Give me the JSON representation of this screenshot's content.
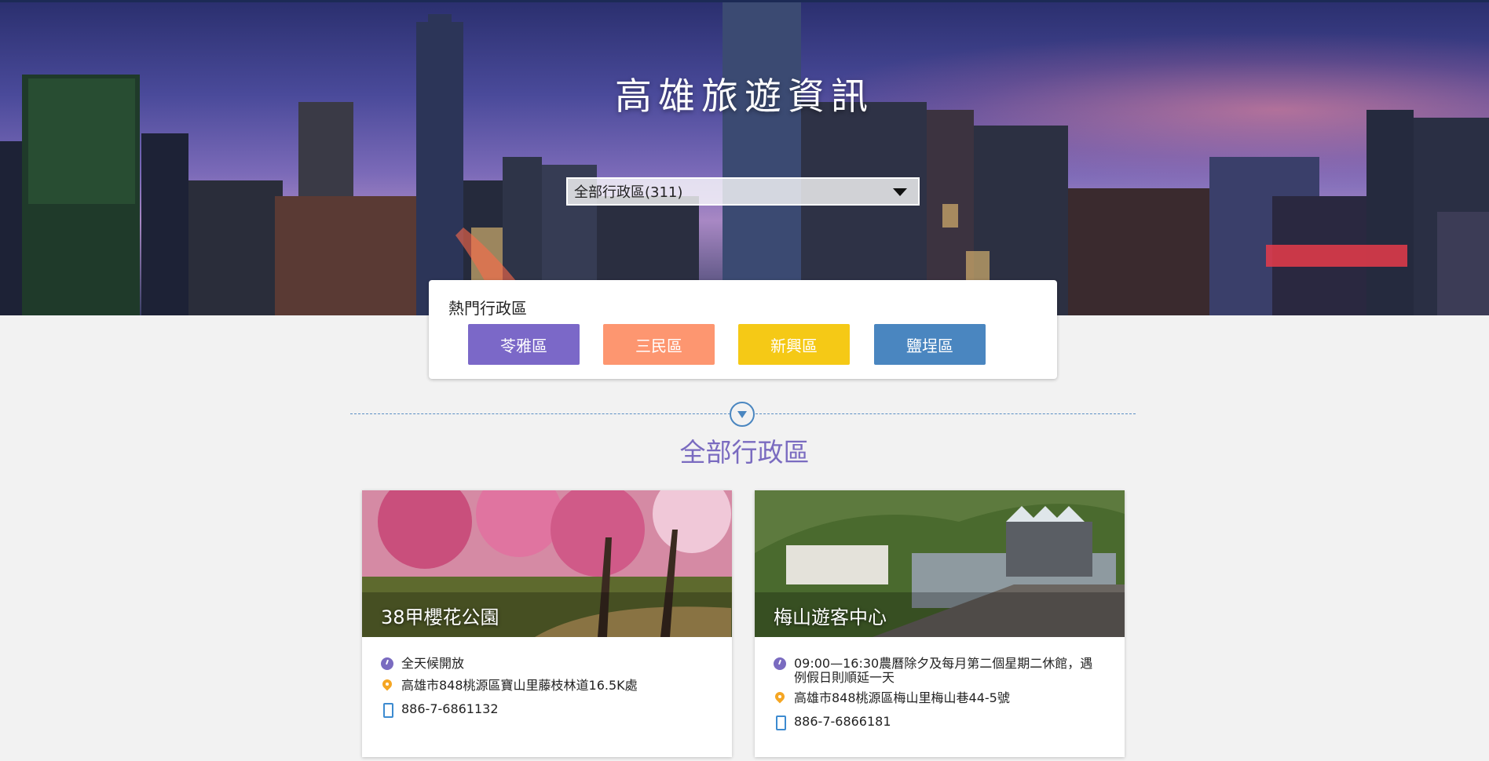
{
  "hero": {
    "title": "高雄旅遊資訊",
    "select_value": "全部行政區(311)"
  },
  "hot": {
    "title": "熱門行政區",
    "buttons": [
      {
        "label": "苓雅區",
        "color": "#7b68c8"
      },
      {
        "label": "三民區",
        "color": "#fd9670"
      },
      {
        "label": "新興區",
        "color": "#f5c916"
      },
      {
        "label": "鹽埕區",
        "color": "#4a86c0"
      }
    ]
  },
  "section": {
    "title": "全部行政區"
  },
  "cards": [
    {
      "name": "38甲櫻花公園",
      "hours": "全天候開放",
      "address": "高雄市848桃源區寶山里藤枝林道16.5K處",
      "phone": "886-7-6861132"
    },
    {
      "name": "梅山遊客中心",
      "hours": "09:00—16:30農曆除夕及每月第二個星期二休館，遇例假日則順延一天",
      "address": "高雄市848桃源區梅山里梅山巷44-5號",
      "phone": "886-7-6866181"
    }
  ],
  "icons": {
    "hours": "clock-icon",
    "address": "map-pin-icon",
    "phone": "phone-icon",
    "select": "caret-down-icon",
    "divider": "arrow-down-circle-icon"
  }
}
